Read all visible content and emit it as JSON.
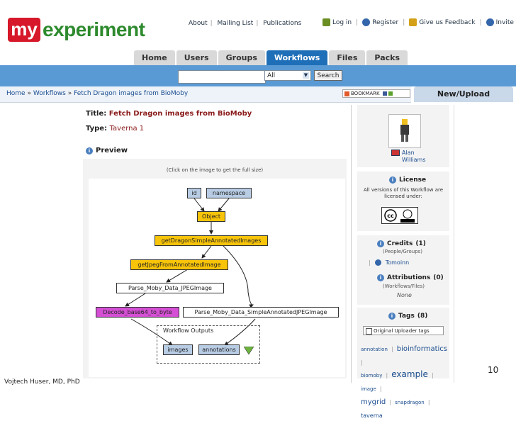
{
  "header": {
    "logo_my": "my",
    "logo_rest": "experiment",
    "top_links": [
      "About",
      "Mailing List",
      "Publications"
    ],
    "user_links": [
      {
        "label": "Log in",
        "icon": "login-icon",
        "color": "#6b8e23"
      },
      {
        "label": "Register",
        "icon": "register-icon",
        "color": "#3366aa"
      },
      {
        "label": "Give us Feedback",
        "icon": "feedback-icon",
        "color": "#d4a017"
      },
      {
        "label": "Invite",
        "icon": "invite-icon",
        "color": "#3366aa"
      }
    ]
  },
  "nav": {
    "tabs": [
      "Home",
      "Users",
      "Groups",
      "Workflows",
      "Files",
      "Packs"
    ],
    "active": "Workflows"
  },
  "search": {
    "value": "",
    "select_value": "All",
    "button_label": "Search"
  },
  "breadcrumb": {
    "items": [
      "Home",
      "Workflows",
      "Fetch Dragon images from BioMoby"
    ],
    "separator": "»"
  },
  "bookmark_label": "BOOKMARK",
  "new_upload_label": "New/Upload",
  "workflow": {
    "title_label": "Title:",
    "title": "Fetch Dragon images from BioMoby",
    "type_label": "Type:",
    "type": "Taverna 1",
    "preview_label": "Preview",
    "preview_hint": "(Click on the image to get the full size)"
  },
  "diagram": {
    "nodes": {
      "id": "id",
      "namespace": "namespace",
      "object": "Object",
      "get_dragon": "getDragonSimpleAnnotatedImages",
      "get_jpeg": "getJpegFromAnnotatedImage",
      "parse_jpeg": "Parse_Moby_Data_JPEGImage",
      "decode": "Decode_base64_to_byte",
      "parse_simple": "Parse_Moby_Data_SimpleAnnotatedJPEGImage",
      "images": "images",
      "annotations": "annotations"
    },
    "outputs_label": "Workflow Outputs"
  },
  "sidebar": {
    "owner_name_line1": "Alan",
    "owner_name_line2": "Williams",
    "license_title": "License",
    "license_text": "All versions of this Workflow are licensed under:",
    "credits_title": "Credits",
    "credits_count": "(1)",
    "credits_sub": "(People/Groups)",
    "credits_person": "Tomoinn",
    "attributions_title": "Attributions",
    "attributions_count": "(0)",
    "attributions_sub": "(Workflows/Files)",
    "attributions_none": "None",
    "tags_title": "Tags",
    "tags_count": "(8)",
    "original_tags_label": "Original Uploader tags",
    "tags": [
      "annotation",
      "bioinformatics",
      "biomoby",
      "example",
      "image",
      "mygrid",
      "snapdragon",
      "taverna"
    ]
  },
  "footer": {
    "page_number": "10",
    "author": "Vojtech Huser, MD, PhD"
  }
}
